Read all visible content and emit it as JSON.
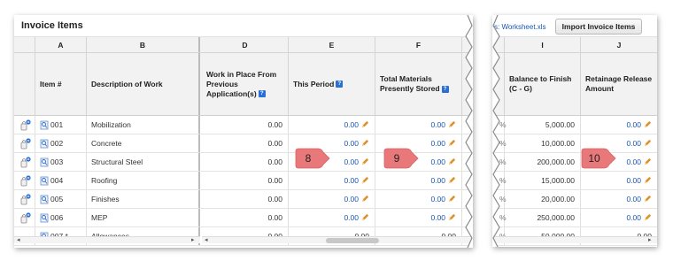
{
  "left": {
    "title": "Invoice Items",
    "letters": [
      "A",
      "B",
      "D",
      "E",
      "F"
    ],
    "headers": {
      "item": "Item #",
      "description": "Description of Work",
      "work_in_place": [
        "Work in Place From",
        "Previous",
        "Application(s)"
      ],
      "this_period": "This Period",
      "materials": [
        "Total Materials",
        "Presently Stored"
      ]
    },
    "rows": [
      {
        "item": "001",
        "description": "Mobilization",
        "wip": "0.00",
        "period": "",
        "materials": ""
      },
      {
        "item": "002",
        "description": "Concrete",
        "wip": "0.00",
        "period": "0.00",
        "materials": "0.00"
      },
      {
        "item": "003",
        "description": "Structural Steel",
        "wip": "0.00",
        "period": "0.00",
        "materials": "0.00"
      },
      {
        "item": "004",
        "description": "Roofing",
        "wip": "0.00",
        "period": "0.00",
        "materials": "0.00"
      },
      {
        "item": "005",
        "description": "Finishes",
        "wip": "0.00",
        "period": "0.00",
        "materials": "0.00"
      },
      {
        "item": "006",
        "description": "MEP",
        "wip": "0.00",
        "period": "0.00",
        "materials": "0.00"
      },
      {
        "item": "007 *",
        "description": "Allowances",
        "wip": "0.00",
        "period": "0.00",
        "materials": "0.00"
      }
    ],
    "row0_period": "0.00",
    "row0_materials": "0.00"
  },
  "right": {
    "worksheet_link": "s: Worksheet.xls",
    "import_button": "Import Invoice Items",
    "letters": [
      "I",
      "J"
    ],
    "headers": {
      "balance": [
        "Balance to Finish",
        "(C - G)"
      ],
      "retainage": [
        "Retainage Release",
        "Amount"
      ]
    },
    "rows": [
      {
        "balance": "5,000.00",
        "retainage": "0.00"
      },
      {
        "balance": "10,000.00",
        "retainage": "0.00"
      },
      {
        "balance": "200,000.00",
        "retainage": "0.00"
      },
      {
        "balance": "15,000.00",
        "retainage": "0.00"
      },
      {
        "balance": "20,000.00",
        "retainage": "0.00"
      },
      {
        "balance": "250,000.00",
        "retainage": "0.00"
      },
      {
        "balance": "50,000.00",
        "retainage": "0.00"
      }
    ]
  },
  "callouts": [
    "8",
    "9",
    "10"
  ],
  "colors": {
    "link": "#1a56b0",
    "callout": "#e8787a",
    "help": "#2a6fd6",
    "pencil": "#e0902a"
  }
}
